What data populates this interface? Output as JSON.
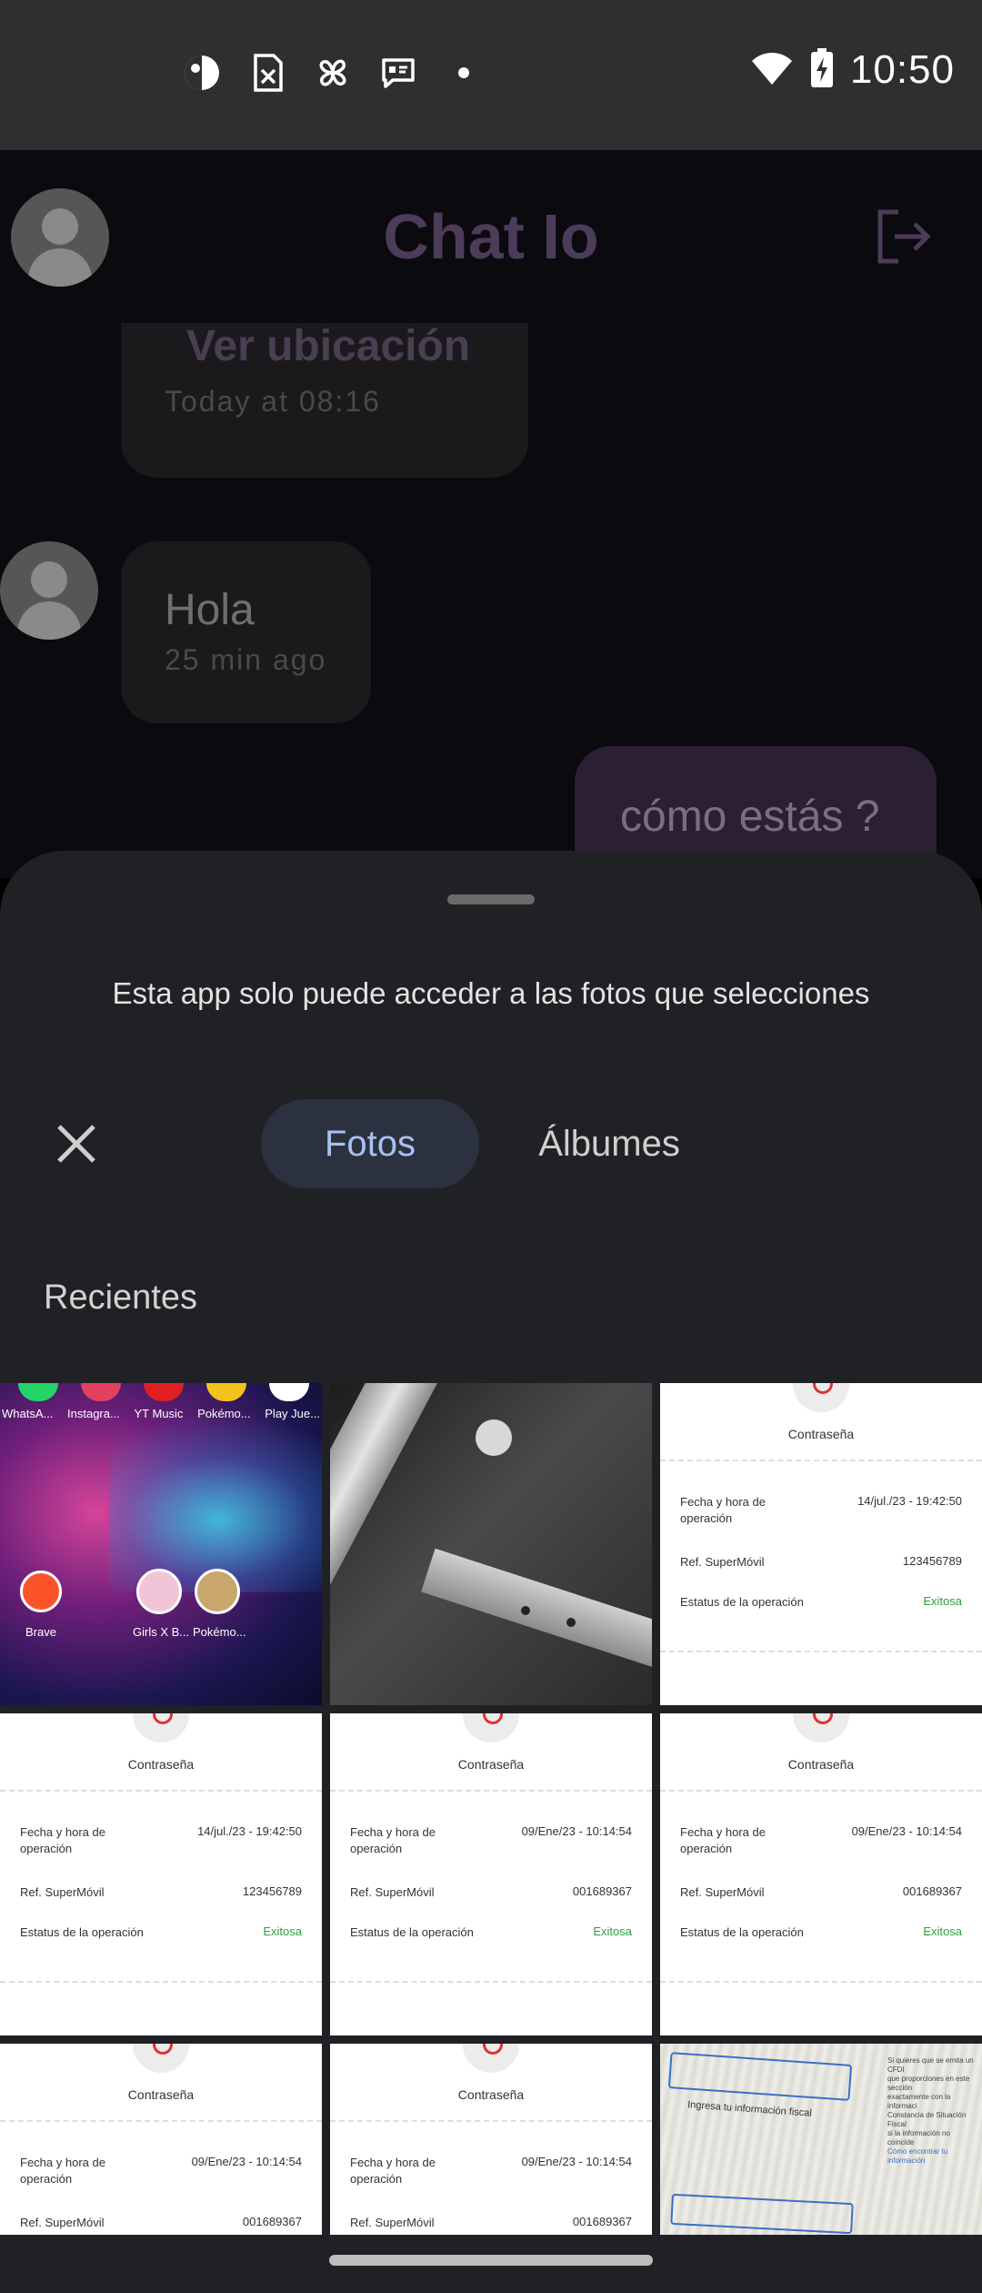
{
  "status_bar": {
    "time": "10:50",
    "left_icons": [
      "assistant-icon",
      "sim-off-icon",
      "pinwheel-icon",
      "message-icon",
      "notification-dot-icon"
    ],
    "right_icons": [
      "wifi-icon",
      "battery-charging-icon"
    ]
  },
  "chat": {
    "title": "Chat Io",
    "messages": [
      {
        "text": "Ver ubicación",
        "time": "Today at 08:16"
      },
      {
        "text": "Hola",
        "time": "25 min ago"
      },
      {
        "text": "cómo estás ?"
      }
    ]
  },
  "picker": {
    "notice": "Esta app solo puede acceder a las fotos que selecciones",
    "tabs": [
      "Fotos",
      "Álbumes"
    ],
    "section_title": "Recientes",
    "home_screen_apps": [
      "WhatsA...",
      "Instagra...",
      "YT Music",
      "Pokémo...",
      "Play Jue...",
      "Brave",
      "Girls X B...",
      "Pokémo..."
    ],
    "receipts": [
      {
        "title": "Contraseña",
        "date_label": "Fecha y hora de operación",
        "date": "14/jul./23 - 19:42:50",
        "ref_label": "Ref. SuperMóvil",
        "ref": "123456789",
        "status_label": "Estatus de la operación",
        "status": "Exitosa"
      },
      {
        "title": "Contraseña",
        "date_label": "Fecha y hora de operación",
        "date": "14/jul./23 - 19:42:50",
        "ref_label": "Ref. SuperMóvil",
        "ref": "123456789",
        "status_label": "Estatus de la operación",
        "status": "Exitosa"
      },
      {
        "title": "Contraseña",
        "date_label": "Fecha y hora de operación",
        "date": "09/Ene/23 - 10:14:54",
        "ref_label": "Ref. SuperMóvil",
        "ref": "001689367",
        "status_label": "Estatus de la operación",
        "status": "Exitosa"
      },
      {
        "title": "Contraseña",
        "date_label": "Fecha y hora de operación",
        "date": "09/Ene/23 - 10:14:54",
        "ref_label": "Ref. SuperMóvil",
        "ref": "001689367",
        "status_label": "Estatus de la operación",
        "status": "Exitosa"
      },
      {
        "title": "Contraseña",
        "date_label": "Fecha y hora de operación",
        "date": "09/Ene/23 - 10:14:54",
        "ref_label": "Ref. SuperMóvil",
        "ref": "001689367"
      },
      {
        "title": "Contraseña",
        "date_label": "Fecha y hora de operación",
        "date": "09/Ene/23 - 10:14:54",
        "ref_label": "Ref. SuperMóvil",
        "ref": "001689367"
      }
    ],
    "document_photo_text": [
      "Si quieres que se emita un CFDI",
      "que proporciones en este sección",
      "exactamente con la informaci",
      "Constancia de Situación Fiscal",
      "si la información no coincide",
      "Cómo encontrar tu información",
      "Ingresa tu información fiscal"
    ]
  },
  "colors": {
    "sheet_bg": "#202124",
    "tab_selected_bg": "#2c3140",
    "tab_selected_text": "#a9c1f2",
    "status_ok": "#2e9f3e",
    "title_purple": "#4c3b59"
  }
}
